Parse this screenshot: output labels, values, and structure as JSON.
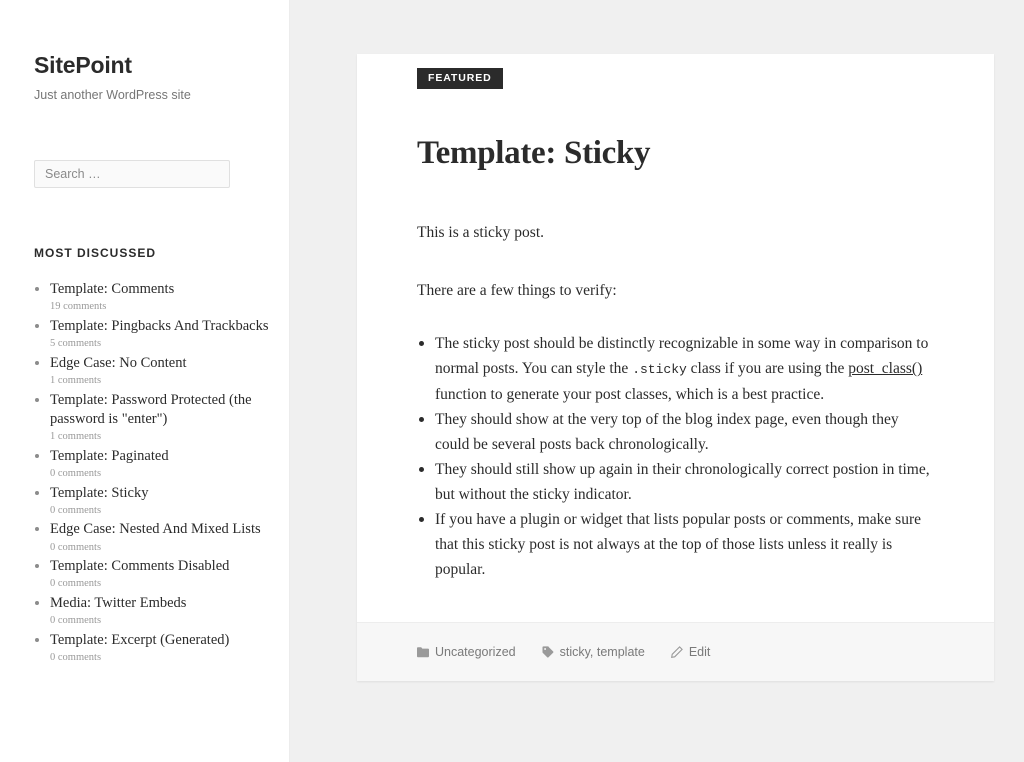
{
  "sidebar": {
    "site_title": "SitePoint",
    "site_description": "Just another WordPress site",
    "search": {
      "placeholder": "Search …",
      "value": ""
    },
    "widget": {
      "title": "Most Discussed",
      "items": [
        {
          "label": "Template: Comments",
          "comments": "19 comments"
        },
        {
          "label": "Template: Pingbacks And Trackbacks",
          "comments": "5 comments"
        },
        {
          "label": "Edge Case: No Content",
          "comments": "1 comments"
        },
        {
          "label": "Template: Password Protected (the password is \"enter\")",
          "comments": "1 comments"
        },
        {
          "label": "Template: Paginated",
          "comments": "0 comments"
        },
        {
          "label": "Template: Sticky",
          "comments": "0 comments"
        },
        {
          "label": "Edge Case: Nested And Mixed Lists",
          "comments": "0 comments"
        },
        {
          "label": "Template: Comments Disabled",
          "comments": "0 comments"
        },
        {
          "label": "Media: Twitter Embeds",
          "comments": "0 comments"
        },
        {
          "label": "Template: Excerpt (Generated)",
          "comments": "0 comments"
        }
      ]
    }
  },
  "post": {
    "badge": "Featured",
    "title": "Template: Sticky",
    "paragraph_1": "This is a sticky post.",
    "paragraph_2": "There are a few things to verify:",
    "bullets": [
      {
        "part_1": "The sticky post should be distinctly recognizable in some way in comparison to normal posts. You can style the ",
        "code": ".sticky",
        "part_2": " class if you are using the ",
        "link": "post_class()",
        "part_3": " function to generate your post classes, which is a best practice."
      },
      {
        "text": "They should show at the very top of the blog index page, even though they could be several posts back chronologically."
      },
      {
        "text": "They should still show up again in their chronologically correct postion in time, but without the sticky indicator."
      },
      {
        "text": "If you have a plugin or widget that lists popular posts or comments, make sure that this sticky post is not always at the top of those lists unless it really is popular."
      }
    ],
    "footer": {
      "category_icon": "folder-icon",
      "category": "Uncategorized",
      "tags_icon": "tag-icon",
      "tags": "sticky, template",
      "edit_icon": "pencil-icon",
      "edit": "Edit"
    }
  },
  "colors": {
    "text": "#2b2b2b",
    "muted": "#767676",
    "page_background": "#f0f0f0",
    "card_background": "#ffffff",
    "badge_background": "#2b2b2b",
    "footer_background": "#f7f7f7"
  }
}
